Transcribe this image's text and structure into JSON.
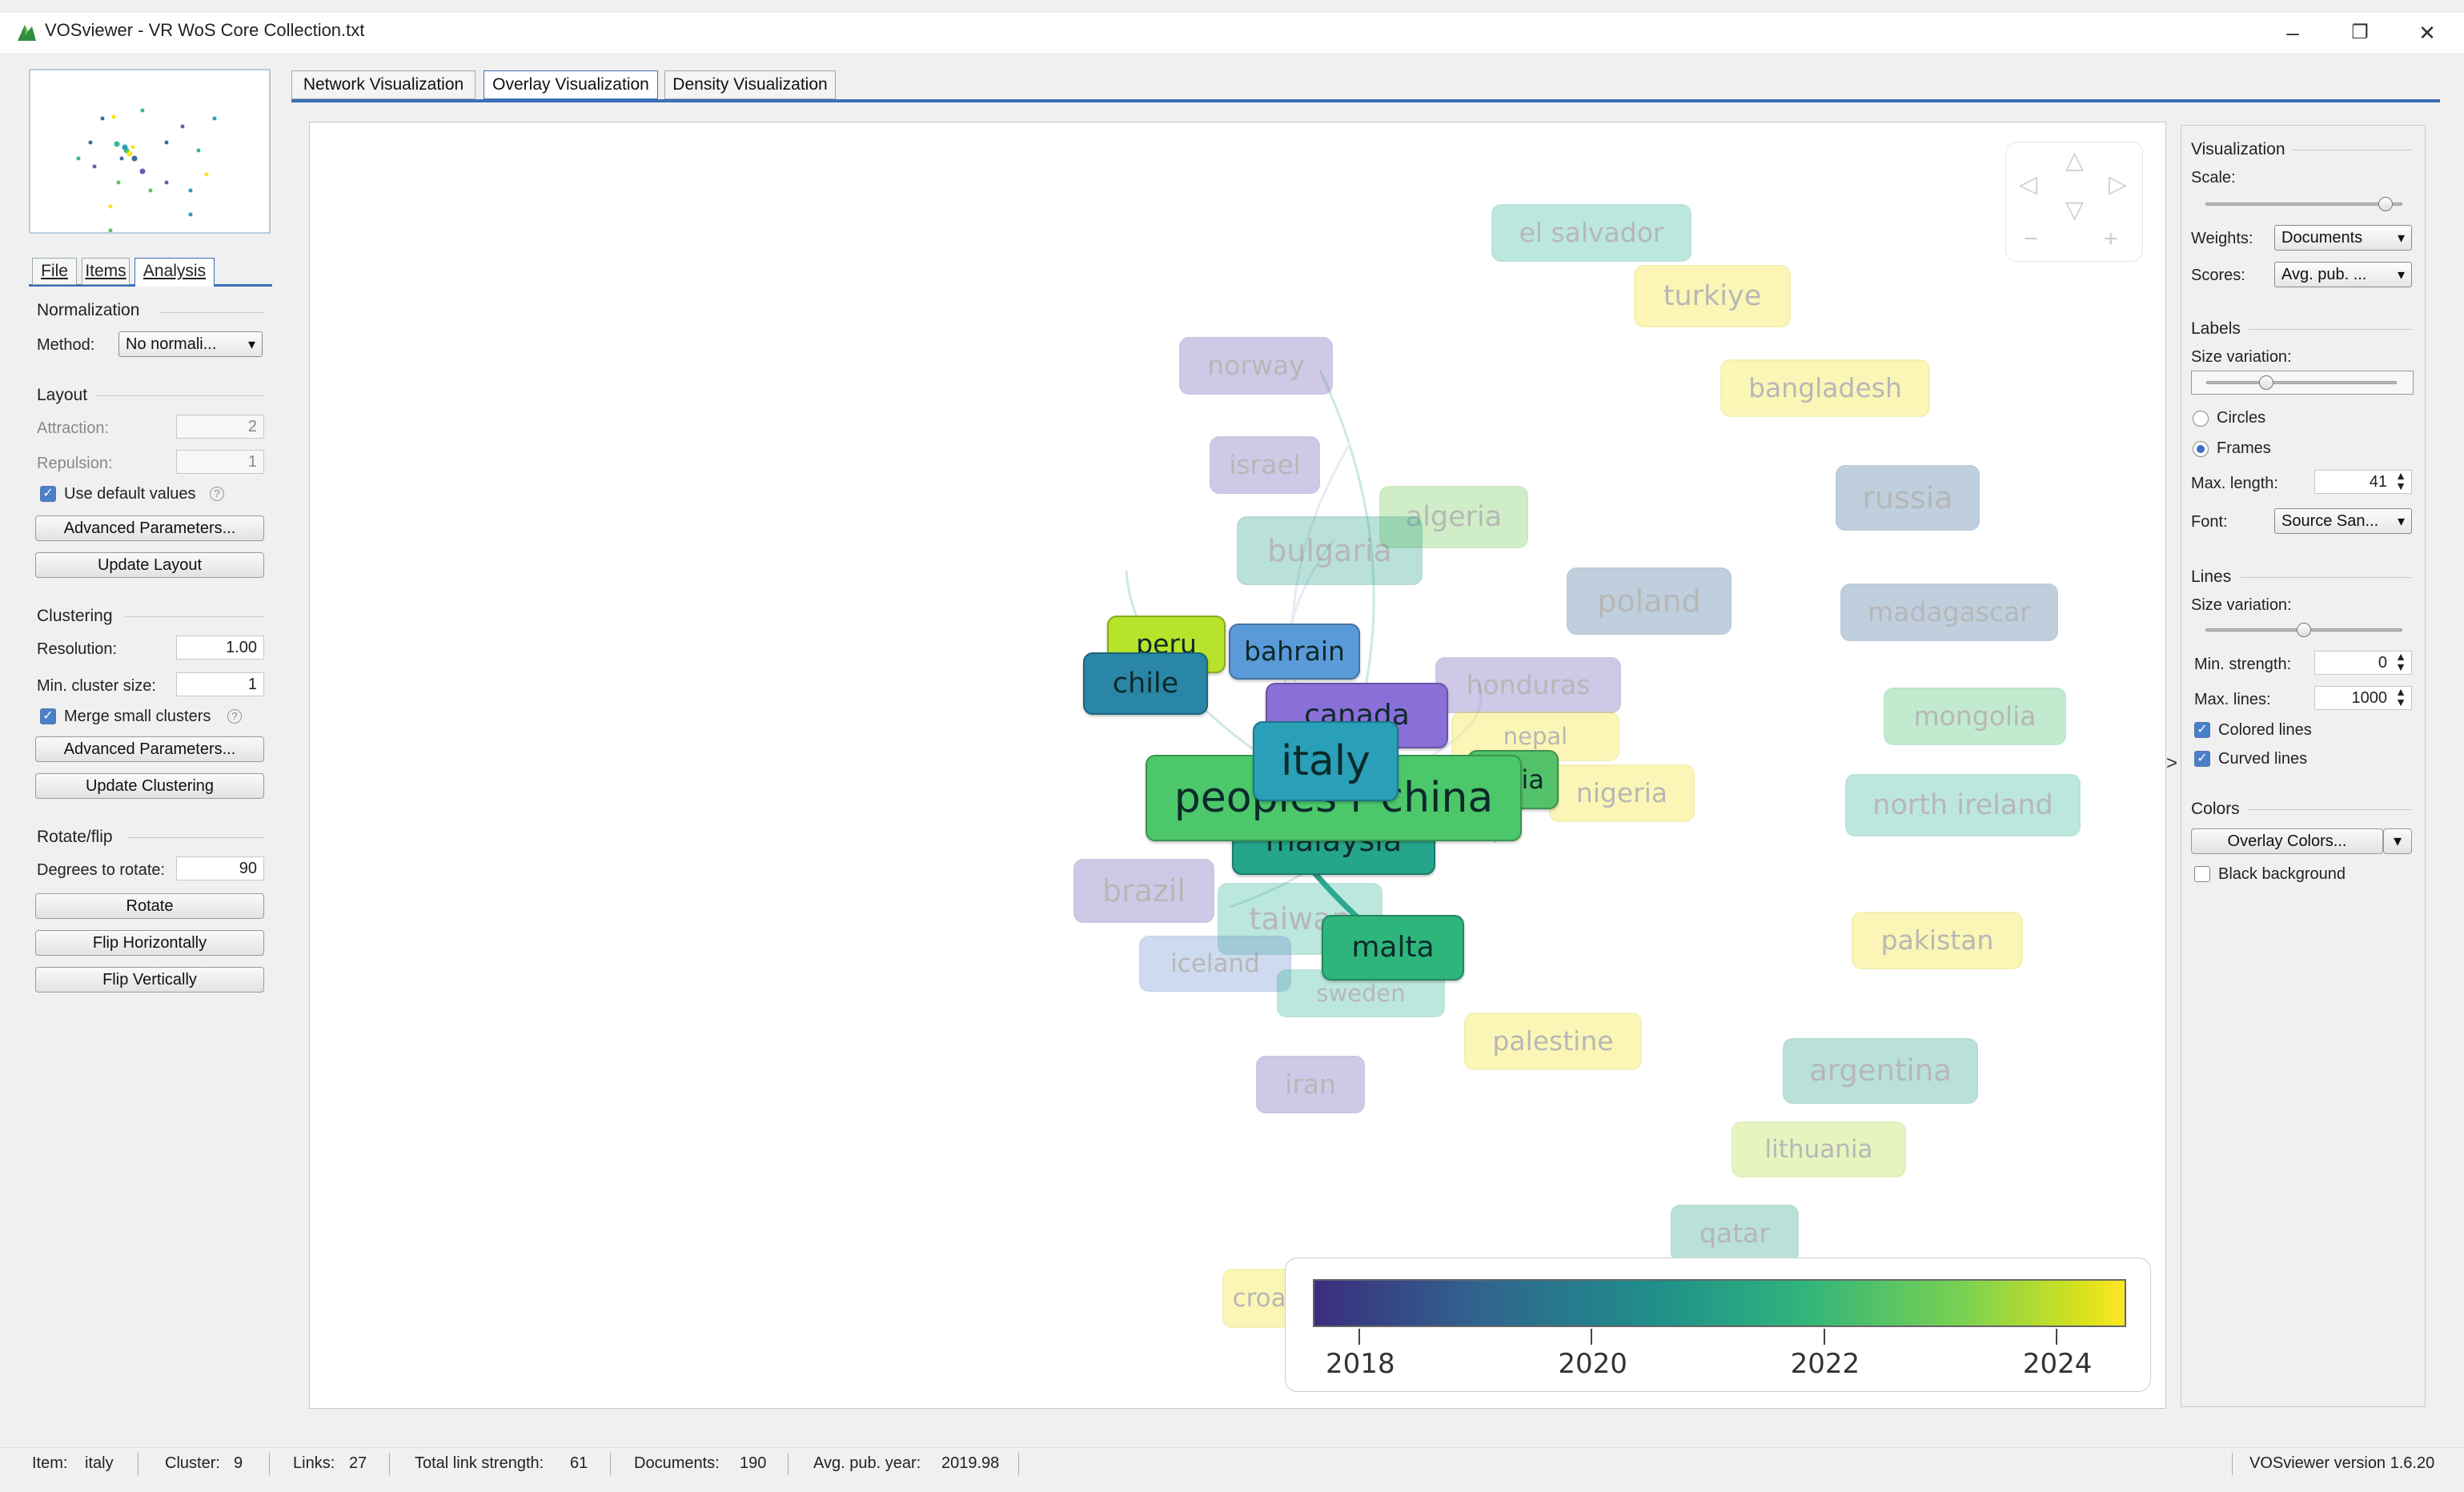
{
  "window": {
    "title": "VOSviewer - VR WoS Core Collection.txt",
    "minimize": "–",
    "restore": "❐",
    "close": "✕"
  },
  "left_tabs": [
    {
      "label": "File"
    },
    {
      "label": "Items"
    },
    {
      "label": "Analysis"
    }
  ],
  "normalization": {
    "heading": "Normalization",
    "method_label": "Method:",
    "method_value": "No normali..."
  },
  "layout": {
    "heading": "Layout",
    "attraction_label": "Attraction:",
    "attraction_value": "2",
    "repulsion_label": "Repulsion:",
    "repulsion_value": "1",
    "use_default_label": "Use default values",
    "advanced_label": "Advanced Parameters...",
    "update_label": "Update Layout"
  },
  "clustering": {
    "heading": "Clustering",
    "resolution_label": "Resolution:",
    "resolution_value": "1.00",
    "min_cluster_label": "Min. cluster size:",
    "min_cluster_value": "1",
    "merge_label": "Merge small clusters",
    "advanced_label": "Advanced Parameters...",
    "update_label": "Update Clustering"
  },
  "rotate": {
    "heading": "Rotate/flip",
    "degrees_label": "Degrees to rotate:",
    "degrees_value": "90",
    "rotate_label": "Rotate",
    "flip_h_label": "Flip Horizontally",
    "flip_v_label": "Flip Vertically"
  },
  "viz_tabs": [
    {
      "label": "Network Visualization"
    },
    {
      "label": "Overlay Visualization"
    },
    {
      "label": "Density Visualization"
    }
  ],
  "nodes": [
    {
      "label": "el salvador",
      "color": "#33b89a",
      "faded": true
    },
    {
      "label": "turkiye",
      "color": "#f3e41f",
      "faded": true
    },
    {
      "label": "norway",
      "color": "#6b5ab5",
      "faded": true
    },
    {
      "label": "bangladesh",
      "color": "#f3e41f",
      "faded": true
    },
    {
      "label": "israel",
      "color": "#6b5ab5",
      "faded": true
    },
    {
      "label": "russia",
      "color": "#3b6d9a",
      "faded": true
    },
    {
      "label": "algeria",
      "color": "#6bcc55",
      "faded": true
    },
    {
      "label": "bulgaria",
      "color": "#2aa38a",
      "faded": true
    },
    {
      "label": "poland",
      "color": "#3b6d9a",
      "faded": true
    },
    {
      "label": "madagascar",
      "color": "#3b6d9a",
      "faded": true
    },
    {
      "label": "honduras",
      "color": "#6b5ab5",
      "faded": true
    },
    {
      "label": "nepal",
      "color": "#f3e41f",
      "faded": true
    },
    {
      "label": "mongolia",
      "color": "#43c06d",
      "faded": true
    },
    {
      "label": "nigeria",
      "color": "#f3e41f",
      "faded": true
    },
    {
      "label": "north ireland",
      "color": "#33b89a",
      "faded": true
    },
    {
      "label": "brazil",
      "color": "#6b5ab5",
      "faded": true
    },
    {
      "label": "taiwan",
      "color": "#33b89a",
      "faded": true
    },
    {
      "label": "pakistan",
      "color": "#f3e41f",
      "faded": true
    },
    {
      "label": "iceland",
      "color": "#6a8fcf",
      "faded": true
    },
    {
      "label": "sweden",
      "color": "#33b89a",
      "faded": true
    },
    {
      "label": "palestine",
      "color": "#f3e41f",
      "faded": true
    },
    {
      "label": "argentina",
      "color": "#2aa38a",
      "faded": true
    },
    {
      "label": "iran",
      "color": "#6b5ab5",
      "faded": true
    },
    {
      "label": "lithuania",
      "color": "#b7df3a",
      "faded": true
    },
    {
      "label": "qatar",
      "color": "#2aa38a",
      "faded": true
    },
    {
      "label": "croatia",
      "color": "#f3e41f",
      "faded": true
    },
    {
      "label": "peru",
      "color": "#b7e32a",
      "faded": false
    },
    {
      "label": "bahrain",
      "color": "#5b9ad8",
      "faded": false
    },
    {
      "label": "chile",
      "color": "#2a86a6",
      "faded": false
    },
    {
      "label": "canada",
      "color": "#8b6fd8",
      "faded": false
    },
    {
      "label": "india",
      "color": "#54c26a",
      "faded": false
    },
    {
      "label": "malaysia",
      "color": "#25a58c",
      "faded": false
    },
    {
      "label": "peoples r china",
      "color": "#4cc76a",
      "faded": false
    },
    {
      "label": "italy",
      "color": "#2a9fb8",
      "faded": false
    },
    {
      "label": "malta",
      "color": "#2db57c",
      "faded": false
    }
  ],
  "legend": {
    "ticks": [
      "2018",
      "2020",
      "2022",
      "2024"
    ],
    "tick_values": [
      2018,
      2020,
      2022,
      2024
    ],
    "min": 2017.6,
    "max": 2024.6
  },
  "visualization": {
    "heading": "Visualization",
    "scale_label": "Scale:",
    "scale_level": 0.95,
    "weights_label": "Weights:",
    "weights_value": "Documents",
    "scores_label": "Scores:",
    "scores_value": "Avg. pub. ..."
  },
  "labels": {
    "heading": "Labels",
    "size_variation_label": "Size variation:",
    "size_level": 0.3,
    "circles_label": "Circles",
    "frames_label": "Frames",
    "max_length_label": "Max. length:",
    "max_length_value": "41",
    "font_label": "Font:",
    "font_value": "Source San..."
  },
  "lines": {
    "heading": "Lines",
    "size_variation_label": "Size variation:",
    "size_level": 0.5,
    "min_strength_label": "Min. strength:",
    "min_strength_value": "0",
    "max_lines_label": "Max. lines:",
    "max_lines_value": "1000",
    "colored_label": "Colored lines",
    "curved_label": "Curved lines"
  },
  "colors": {
    "heading": "Colors",
    "overlay_label": "Overlay Colors...",
    "black_bg_label": "Black background"
  },
  "status": {
    "item_label": "Item:",
    "item_value": "italy",
    "cluster_label": "Cluster:",
    "cluster_value": "9",
    "links_label": "Links:",
    "links_value": "27",
    "tls_label": "Total link strength:",
    "tls_value": "61",
    "docs_label": "Documents:",
    "docs_value": "190",
    "avg_label": "Avg. pub. year:",
    "avg_value": "2019.98",
    "version": "VOSviewer version 1.6.20"
  }
}
